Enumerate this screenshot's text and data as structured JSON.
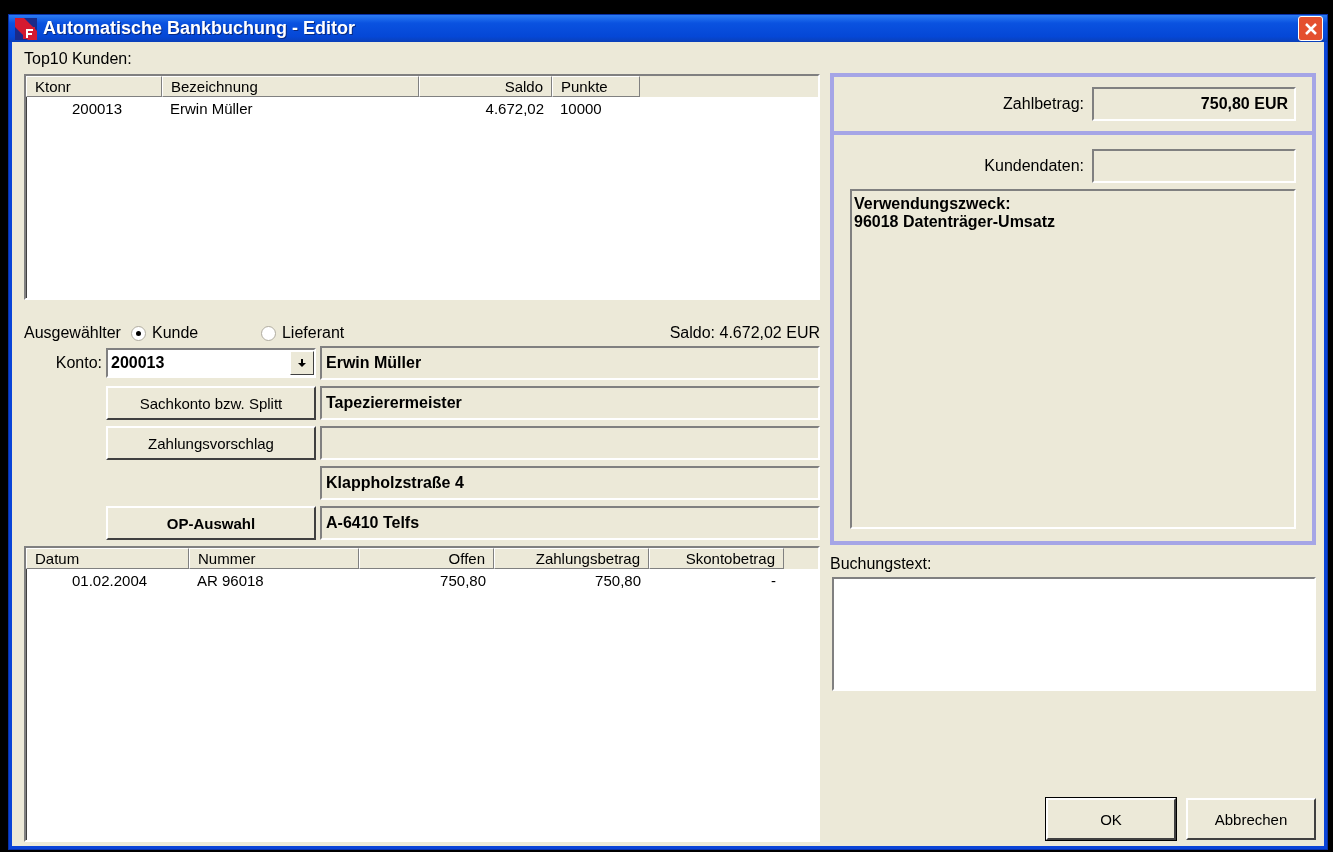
{
  "window": {
    "title": "Automatische Bankbuchung - Editor"
  },
  "top_list": {
    "label": "Top10 Kunden:",
    "columns": [
      "Ktonr",
      "Bezeichnung",
      "Saldo",
      "Punkte"
    ],
    "rows": [
      [
        "200013",
        "Erwin Müller",
        "4.672,02",
        "10000"
      ]
    ]
  },
  "selection": {
    "label": "Ausgewählter",
    "options": [
      {
        "label": "Kunde",
        "selected": true
      },
      {
        "label": "Lieferant",
        "selected": false
      }
    ],
    "saldo": "Saldo: 4.672,02 EUR"
  },
  "account": {
    "label": "Konto:",
    "value": "200013"
  },
  "side_buttons": [
    {
      "label": "Sachkonto bzw. Splitt",
      "emphasized": false
    },
    {
      "label": "Zahlungsvorschlag",
      "emphasized": false
    },
    {
      "label": "OP-Auswahl",
      "emphasized": true
    }
  ],
  "address_fields": [
    {
      "kind": "text",
      "value": "Erwin Müller"
    },
    {
      "kind": "text",
      "value": "Tapezierermeister"
    },
    {
      "kind": "empty"
    },
    {
      "kind": "text",
      "value": "Klappholzstraße 4"
    },
    {
      "kind": "text",
      "value": "A-6410 Telfs"
    }
  ],
  "open_items": {
    "columns": [
      "Datum",
      "Nummer",
      "Offen",
      "Zahlungsbetrag",
      "Skontobetrag"
    ],
    "rows": [
      [
        "01.02.2004",
        "AR 96018",
        "750,80",
        "750,80",
        "-"
      ]
    ]
  },
  "payment": {
    "label": "Zahlbetrag:",
    "value": "750,80 EUR"
  },
  "customer_data": {
    "label": "Kundendaten:"
  },
  "purpose": {
    "text": "Verwendungszweck:\n96018 Datenträger-Umsatz"
  },
  "booking_text": {
    "label": "Buchungstext:"
  },
  "dialog_buttons": [
    {
      "label": "OK",
      "default": true
    },
    {
      "label": "Abbrechen",
      "default": false
    }
  ]
}
